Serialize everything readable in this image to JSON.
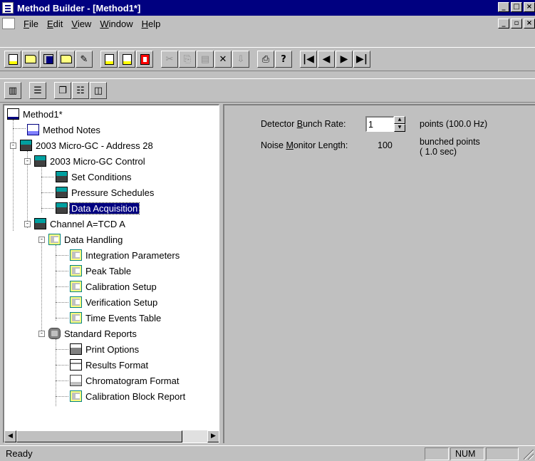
{
  "window": {
    "title": "Method Builder - [Method1*]"
  },
  "menu": [
    {
      "label": "File",
      "accel": "F",
      "rest": "ile"
    },
    {
      "label": "Edit",
      "accel": "E",
      "rest": "dit"
    },
    {
      "label": "View",
      "accel": "V",
      "rest": "iew"
    },
    {
      "label": "Window",
      "accel": "W",
      "rest": "indow"
    },
    {
      "label": "Help",
      "accel": "H",
      "rest": "elp"
    }
  ],
  "toolbar": {
    "buttons": [
      "new-document-icon",
      "open-folder-icon",
      "save-icon",
      "open-template-icon",
      "edit-icon",
      "method-icon-1",
      "method-icon-2",
      "delete-method-icon",
      "cut-icon",
      "copy-icon",
      "paste-icon",
      "delete-icon",
      "import-icon",
      "print-icon",
      "help-icon",
      "first-icon",
      "previous-icon",
      "next-icon",
      "last-icon"
    ]
  },
  "tree": {
    "items": [
      {
        "label": "Method1*"
      },
      {
        "label": "Method Notes"
      },
      {
        "label": "2003 Micro-GC - Address 28"
      },
      {
        "label": "2003 Micro-GC Control"
      },
      {
        "label": "Set Conditions"
      },
      {
        "label": "Pressure Schedules"
      },
      {
        "label": "Data Acquisition"
      },
      {
        "label": "Channel A=TCD A"
      },
      {
        "label": "Data Handling"
      },
      {
        "label": "Integration Parameters"
      },
      {
        "label": "Peak Table"
      },
      {
        "label": "Calibration Setup"
      },
      {
        "label": "Verification Setup"
      },
      {
        "label": "Time Events Table"
      },
      {
        "label": "Standard Reports"
      },
      {
        "label": "Print Options"
      },
      {
        "label": "Results Format"
      },
      {
        "label": "Chromatogram Format"
      },
      {
        "label": "Calibration Block Report"
      }
    ],
    "selected": "Data Acquisition"
  },
  "settings": {
    "bunch_rate_pre": "Detector ",
    "bunch_rate_accel": "B",
    "bunch_rate_post": "unch Rate:",
    "bunch_rate_value": "1",
    "bunch_rate_unit": "points (100.0 Hz)",
    "noise_pre": "Noise ",
    "noise_accel": "M",
    "noise_post": "onitor Length:",
    "noise_value": "100",
    "noise_unit_1": "bunched points",
    "noise_unit_2": "( 1.0 sec)"
  },
  "status": {
    "text": "Ready",
    "num": "NUM"
  }
}
